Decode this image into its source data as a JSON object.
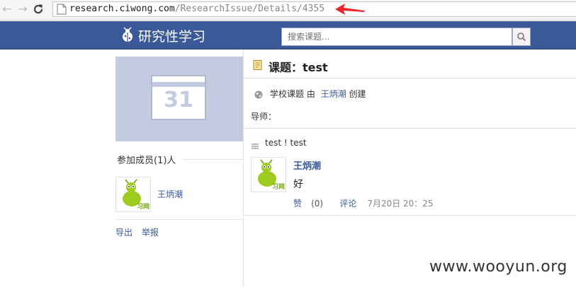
{
  "browser": {
    "url_host": "research.ciwong.com",
    "url_path": "/ResearchIssue/Details/4355"
  },
  "header": {
    "logo_text": "研究性学习",
    "search_placeholder": "搜索课题..."
  },
  "sidebar": {
    "calendar_day": "31",
    "members_title": "参加成员(1)人",
    "members": [
      {
        "name": "王炳潮"
      }
    ],
    "export_label": "导出",
    "report_label": "举报"
  },
  "topic": {
    "title": "课题：test",
    "meta_type": "学校课题",
    "meta_by": "由",
    "meta_creator": "王炳潮",
    "meta_action": "创建",
    "mentor_label": "导师："
  },
  "post": {
    "section_text": "test ! test",
    "author": "王炳潮",
    "body": "好",
    "like_label": "赞",
    "like_count": "(0)",
    "comment_label": "评论",
    "timestamp": "7月20日 20：25"
  },
  "watermark": "www.wooyun.org",
  "colors": {
    "header_bg": "#3b5998",
    "link": "#3b5998",
    "calendar_bg": "#c2cbe0",
    "annotation_arrow": "#e8262a"
  }
}
